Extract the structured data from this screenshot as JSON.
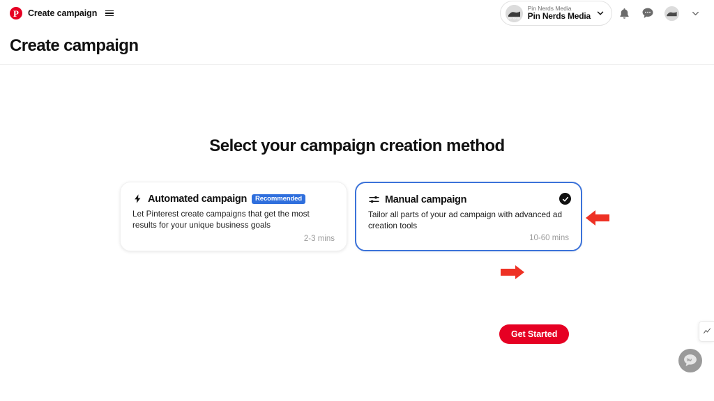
{
  "topbar": {
    "logo_icon": "pinterest-logo-icon",
    "logo_glyph": "P",
    "brand_label": "Create campaign",
    "menu_icon": "hamburger-menu-icon",
    "account": {
      "sub_label": "Pin Nerds Media",
      "name_label": "Pin Nerds Media",
      "avatar_icon": "account-avatar-icon",
      "chevron_icon": "chevron-down-icon"
    },
    "actions": [
      {
        "name": "notifications-button",
        "icon": "bell-icon"
      },
      {
        "name": "messages-button",
        "icon": "chat-bubble-icon"
      },
      {
        "name": "profile-button",
        "icon": "user-avatar-icon"
      },
      {
        "name": "account-menu-button",
        "icon": "chevron-down-icon"
      }
    ]
  },
  "page": {
    "title": "Create campaign"
  },
  "main": {
    "section_title": "Select your campaign creation method",
    "cards": [
      {
        "id": "automated",
        "icon": "lightning-bolt-icon",
        "title": "Automated campaign",
        "badge": "Recommended",
        "description": "Let Pinterest create campaigns that get the most results for your unique business goals",
        "time": "2-3 mins",
        "selected": false
      },
      {
        "id": "manual",
        "icon": "sliders-icon",
        "title": "Manual campaign",
        "badge": "",
        "description": "Tailor all parts of your ad campaign with advanced ad creation tools",
        "time": "10-60 mins",
        "selected": true,
        "check_icon": "check-circle-icon"
      }
    ],
    "cta": {
      "label": "Get Started"
    }
  },
  "annotations": [
    {
      "name": "arrow-pointing-to-manual-card",
      "icon": "arrow-left-icon",
      "color": "#ee3124"
    },
    {
      "name": "arrow-pointing-to-get-started",
      "icon": "arrow-right-icon",
      "color": "#ee3124"
    }
  ],
  "widgets": {
    "side_tab_icon": "analytics-tab-icon",
    "chat_fab_icon": "support-chat-icon"
  },
  "colors": {
    "brand_red": "#e60023",
    "badge_blue": "#2f6fdd",
    "selected_border": "#3b72d9",
    "annotation_red": "#ee3124"
  }
}
